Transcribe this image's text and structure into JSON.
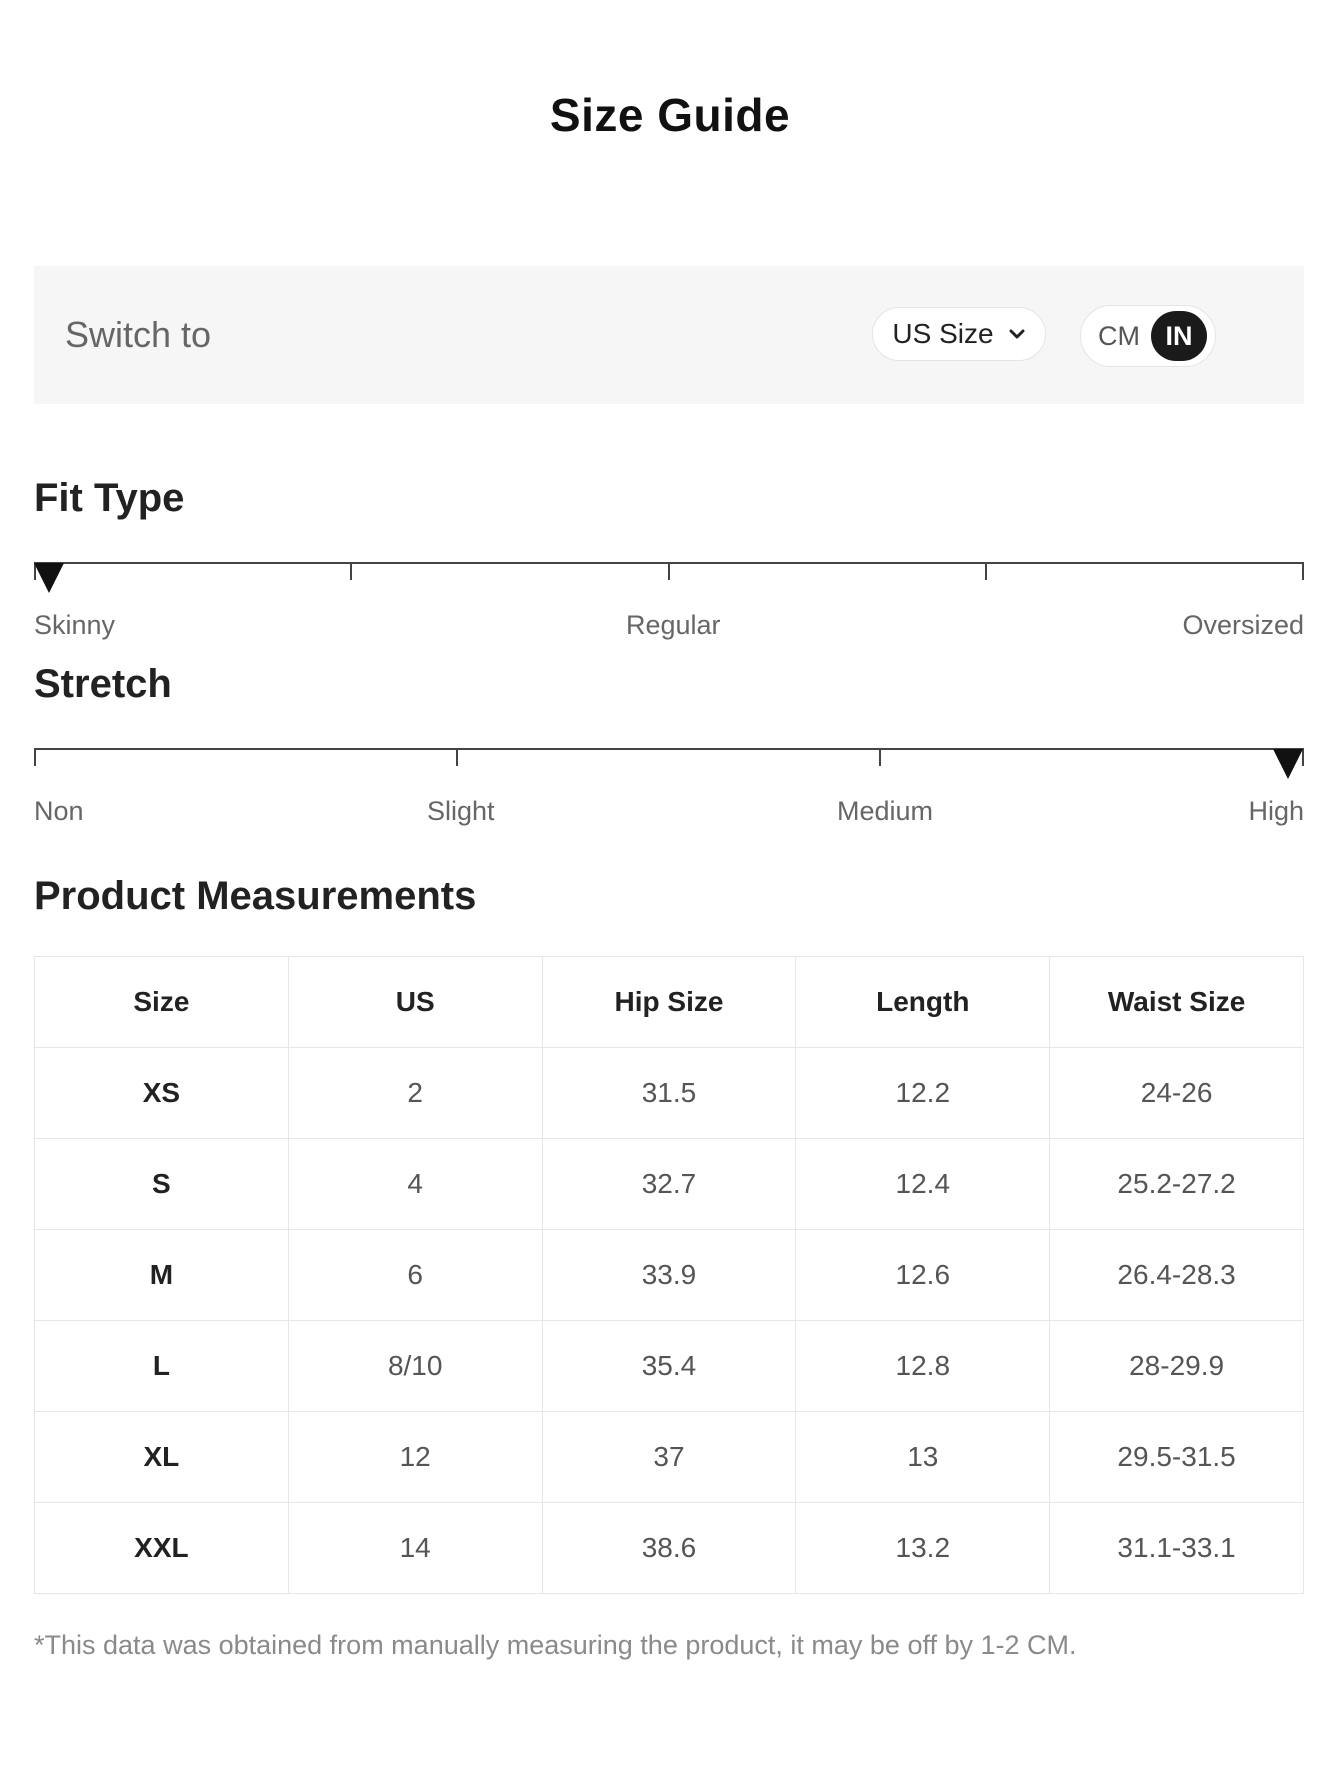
{
  "title": "Size Guide",
  "switch_bar": {
    "label": "Switch to",
    "size_system": "US Size",
    "units": [
      "CM",
      "IN"
    ],
    "selected_unit": "IN"
  },
  "fit_type": {
    "heading": "Fit Type",
    "labels": [
      "Skinny",
      "Regular",
      "Oversized"
    ],
    "selected": "Skinny"
  },
  "stretch": {
    "heading": "Stretch",
    "labels": [
      "Non",
      "Slight",
      "Medium",
      "High"
    ],
    "selected": "High"
  },
  "measurements": {
    "heading": "Product Measurements",
    "columns": [
      "Size",
      "US",
      "Hip Size",
      "Length",
      "Waist Size"
    ],
    "rows": [
      [
        "XS",
        "2",
        "31.5",
        "12.2",
        "24-26"
      ],
      [
        "S",
        "4",
        "32.7",
        "12.4",
        "25.2-27.2"
      ],
      [
        "M",
        "6",
        "33.9",
        "12.6",
        "26.4-28.3"
      ],
      [
        "L",
        "8/10",
        "35.4",
        "12.8",
        "28-29.9"
      ],
      [
        "XL",
        "12",
        "37",
        "13",
        "29.5-31.5"
      ],
      [
        "XXL",
        "14",
        "38.6",
        "13.2",
        "31.1-33.1"
      ]
    ]
  },
  "footnote": "*This data was obtained from manually measuring the product, it may be off by 1-2 CM.",
  "icons": {
    "size_select": "chevron-down-icon",
    "scale_marker": "triangle-down-icon"
  }
}
